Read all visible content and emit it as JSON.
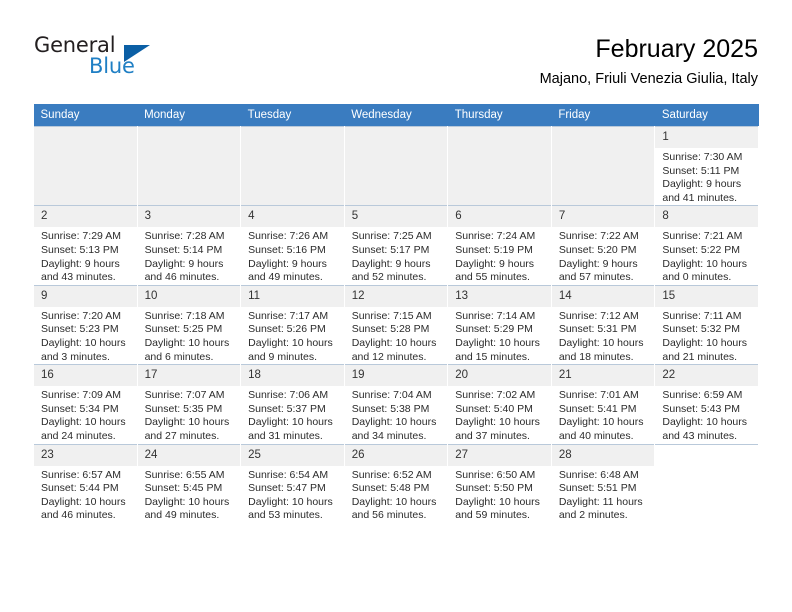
{
  "brand": {
    "word_general": "General",
    "word_blue": "Blue",
    "triangle_icon": "brand-triangle-icon",
    "accent_color": "#1f7fc4"
  },
  "header": {
    "title": "February 2025",
    "location": "Majano, Friuli Venezia Giulia, Italy"
  },
  "theme": {
    "header_row_bg": "#3a7cc0",
    "daynum_bg": "#f0f0f0",
    "grid_line": "#b9c9da"
  },
  "calendar": {
    "weekday_headers": [
      "Sunday",
      "Monday",
      "Tuesday",
      "Wednesday",
      "Thursday",
      "Friday",
      "Saturday"
    ],
    "weeks": [
      [
        {
          "day": "",
          "empty": true
        },
        {
          "day": "",
          "empty": true
        },
        {
          "day": "",
          "empty": true
        },
        {
          "day": "",
          "empty": true
        },
        {
          "day": "",
          "empty": true
        },
        {
          "day": "",
          "empty": true
        },
        {
          "day": "1",
          "sunrise": "Sunrise: 7:30 AM",
          "sunset": "Sunset: 5:11 PM",
          "daylight1": "Daylight: 9 hours",
          "daylight2": "and 41 minutes."
        }
      ],
      [
        {
          "day": "2",
          "sunrise": "Sunrise: 7:29 AM",
          "sunset": "Sunset: 5:13 PM",
          "daylight1": "Daylight: 9 hours",
          "daylight2": "and 43 minutes."
        },
        {
          "day": "3",
          "sunrise": "Sunrise: 7:28 AM",
          "sunset": "Sunset: 5:14 PM",
          "daylight1": "Daylight: 9 hours",
          "daylight2": "and 46 minutes."
        },
        {
          "day": "4",
          "sunrise": "Sunrise: 7:26 AM",
          "sunset": "Sunset: 5:16 PM",
          "daylight1": "Daylight: 9 hours",
          "daylight2": "and 49 minutes."
        },
        {
          "day": "5",
          "sunrise": "Sunrise: 7:25 AM",
          "sunset": "Sunset: 5:17 PM",
          "daylight1": "Daylight: 9 hours",
          "daylight2": "and 52 minutes."
        },
        {
          "day": "6",
          "sunrise": "Sunrise: 7:24 AM",
          "sunset": "Sunset: 5:19 PM",
          "daylight1": "Daylight: 9 hours",
          "daylight2": "and 55 minutes."
        },
        {
          "day": "7",
          "sunrise": "Sunrise: 7:22 AM",
          "sunset": "Sunset: 5:20 PM",
          "daylight1": "Daylight: 9 hours",
          "daylight2": "and 57 minutes."
        },
        {
          "day": "8",
          "sunrise": "Sunrise: 7:21 AM",
          "sunset": "Sunset: 5:22 PM",
          "daylight1": "Daylight: 10 hours",
          "daylight2": "and 0 minutes."
        }
      ],
      [
        {
          "day": "9",
          "sunrise": "Sunrise: 7:20 AM",
          "sunset": "Sunset: 5:23 PM",
          "daylight1": "Daylight: 10 hours",
          "daylight2": "and 3 minutes."
        },
        {
          "day": "10",
          "sunrise": "Sunrise: 7:18 AM",
          "sunset": "Sunset: 5:25 PM",
          "daylight1": "Daylight: 10 hours",
          "daylight2": "and 6 minutes."
        },
        {
          "day": "11",
          "sunrise": "Sunrise: 7:17 AM",
          "sunset": "Sunset: 5:26 PM",
          "daylight1": "Daylight: 10 hours",
          "daylight2": "and 9 minutes."
        },
        {
          "day": "12",
          "sunrise": "Sunrise: 7:15 AM",
          "sunset": "Sunset: 5:28 PM",
          "daylight1": "Daylight: 10 hours",
          "daylight2": "and 12 minutes."
        },
        {
          "day": "13",
          "sunrise": "Sunrise: 7:14 AM",
          "sunset": "Sunset: 5:29 PM",
          "daylight1": "Daylight: 10 hours",
          "daylight2": "and 15 minutes."
        },
        {
          "day": "14",
          "sunrise": "Sunrise: 7:12 AM",
          "sunset": "Sunset: 5:31 PM",
          "daylight1": "Daylight: 10 hours",
          "daylight2": "and 18 minutes."
        },
        {
          "day": "15",
          "sunrise": "Sunrise: 7:11 AM",
          "sunset": "Sunset: 5:32 PM",
          "daylight1": "Daylight: 10 hours",
          "daylight2": "and 21 minutes."
        }
      ],
      [
        {
          "day": "16",
          "sunrise": "Sunrise: 7:09 AM",
          "sunset": "Sunset: 5:34 PM",
          "daylight1": "Daylight: 10 hours",
          "daylight2": "and 24 minutes."
        },
        {
          "day": "17",
          "sunrise": "Sunrise: 7:07 AM",
          "sunset": "Sunset: 5:35 PM",
          "daylight1": "Daylight: 10 hours",
          "daylight2": "and 27 minutes."
        },
        {
          "day": "18",
          "sunrise": "Sunrise: 7:06 AM",
          "sunset": "Sunset: 5:37 PM",
          "daylight1": "Daylight: 10 hours",
          "daylight2": "and 31 minutes."
        },
        {
          "day": "19",
          "sunrise": "Sunrise: 7:04 AM",
          "sunset": "Sunset: 5:38 PM",
          "daylight1": "Daylight: 10 hours",
          "daylight2": "and 34 minutes."
        },
        {
          "day": "20",
          "sunrise": "Sunrise: 7:02 AM",
          "sunset": "Sunset: 5:40 PM",
          "daylight1": "Daylight: 10 hours",
          "daylight2": "and 37 minutes."
        },
        {
          "day": "21",
          "sunrise": "Sunrise: 7:01 AM",
          "sunset": "Sunset: 5:41 PM",
          "daylight1": "Daylight: 10 hours",
          "daylight2": "and 40 minutes."
        },
        {
          "day": "22",
          "sunrise": "Sunrise: 6:59 AM",
          "sunset": "Sunset: 5:43 PM",
          "daylight1": "Daylight: 10 hours",
          "daylight2": "and 43 minutes."
        }
      ],
      [
        {
          "day": "23",
          "sunrise": "Sunrise: 6:57 AM",
          "sunset": "Sunset: 5:44 PM",
          "daylight1": "Daylight: 10 hours",
          "daylight2": "and 46 minutes."
        },
        {
          "day": "24",
          "sunrise": "Sunrise: 6:55 AM",
          "sunset": "Sunset: 5:45 PM",
          "daylight1": "Daylight: 10 hours",
          "daylight2": "and 49 minutes."
        },
        {
          "day": "25",
          "sunrise": "Sunrise: 6:54 AM",
          "sunset": "Sunset: 5:47 PM",
          "daylight1": "Daylight: 10 hours",
          "daylight2": "and 53 minutes."
        },
        {
          "day": "26",
          "sunrise": "Sunrise: 6:52 AM",
          "sunset": "Sunset: 5:48 PM",
          "daylight1": "Daylight: 10 hours",
          "daylight2": "and 56 minutes."
        },
        {
          "day": "27",
          "sunrise": "Sunrise: 6:50 AM",
          "sunset": "Sunset: 5:50 PM",
          "daylight1": "Daylight: 10 hours",
          "daylight2": "and 59 minutes."
        },
        {
          "day": "28",
          "sunrise": "Sunrise: 6:48 AM",
          "sunset": "Sunset: 5:51 PM",
          "daylight1": "Daylight: 11 hours",
          "daylight2": "and 2 minutes."
        },
        {
          "day": "",
          "empty": true,
          "tail": true
        }
      ]
    ]
  }
}
